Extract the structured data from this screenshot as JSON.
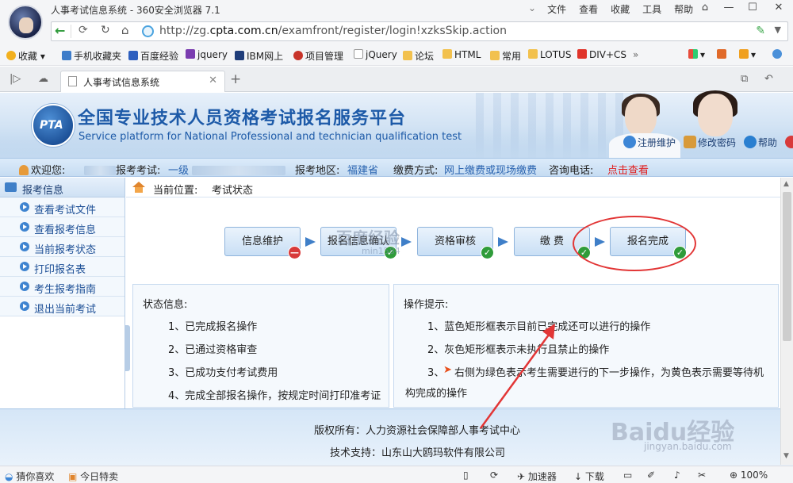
{
  "browser": {
    "window_title": "人事考试信息系统 - 360安全浏览器 7.1",
    "menu": [
      "文件",
      "查看",
      "收藏",
      "工具",
      "帮助"
    ],
    "url_prefix": "http://zg.",
    "url_domain": "cpta.com.cn",
    "url_path": "/examfront/register/login!xzksSkip.action",
    "bookmarks": [
      "收藏",
      "手机收藏夹",
      "百度经验",
      "jquery",
      "IBM网上",
      "项目管理",
      "jQuery",
      "论坛",
      "HTML",
      "常用",
      "LOTUS",
      "DIV+CS"
    ],
    "tab_title": "人事考试信息系统",
    "status_left": [
      "猜你喜欢",
      "今日特卖"
    ],
    "status_right": [
      "加速器",
      "下载",
      "100%"
    ]
  },
  "header": {
    "logo_text": "PTA",
    "title": "全国专业技术人员资格考试报名服务平台",
    "subtitle": "Service platform for National Professional and technician qualification test",
    "links": [
      "注册维护",
      "修改密码",
      "帮助"
    ]
  },
  "welcome": {
    "greeting": "欢迎您:",
    "exam_label": "报考考试:",
    "exam_value": "一级",
    "region_label": "报考地区:",
    "region_value": "福建省",
    "pay_label": "缴费方式:",
    "pay_value": "网上缴费或现场缴费",
    "contact_label": "咨询电话:",
    "contact_value": "点击查看"
  },
  "sidebar": {
    "title": "报考信息",
    "items": [
      "查看考试文件",
      "查看报考信息",
      "当前报考状态",
      "打印报名表",
      "考生报考指南",
      "退出当前考试"
    ]
  },
  "breadcrumb": {
    "label": "当前位置:",
    "value": "考试状态"
  },
  "steps": [
    {
      "label": "信息维护",
      "status": "no"
    },
    {
      "label": "报名信息确认",
      "status": "ok"
    },
    {
      "label": "资格审核",
      "status": "ok"
    },
    {
      "label": "缴 费",
      "status": "ok"
    },
    {
      "label": "报名完成",
      "status": "ok"
    }
  ],
  "status_panel": {
    "title": "状态信息:",
    "items": [
      "1、已完成报名操作",
      "2、已通过资格审查",
      "3、已成功支付考试费用",
      "4、完成全部报名操作，按规定时间打印准考证"
    ]
  },
  "tips_panel": {
    "title": "操作提示:",
    "items": [
      "1、蓝色矩形框表示目前已完成还可以进行的操作",
      "2、灰色矩形框表示未执行且禁止的操作",
      "3、",
      "右侧为绿色表示考生需要进行的下一步操作，为黄色表示需要等待机",
      "构完成的操作"
    ]
  },
  "footer": {
    "copyright": "版权所有：人力资源社会保障部人事考试中心",
    "tech": "技术支持：山东山大鸥玛软件有限公司"
  },
  "watermark": {
    "center_text": "百度经验",
    "center_sub": "min1584",
    "corner_text": "Baidu经验",
    "corner_sub": "jingyan.baidu.com"
  },
  "colors": {
    "accent_blue": "#1d5aa8",
    "link_blue": "#2a64b0",
    "ok_green": "#2f9c3a",
    "error_red": "#d83a3a",
    "annotation_red": "#e23636"
  }
}
